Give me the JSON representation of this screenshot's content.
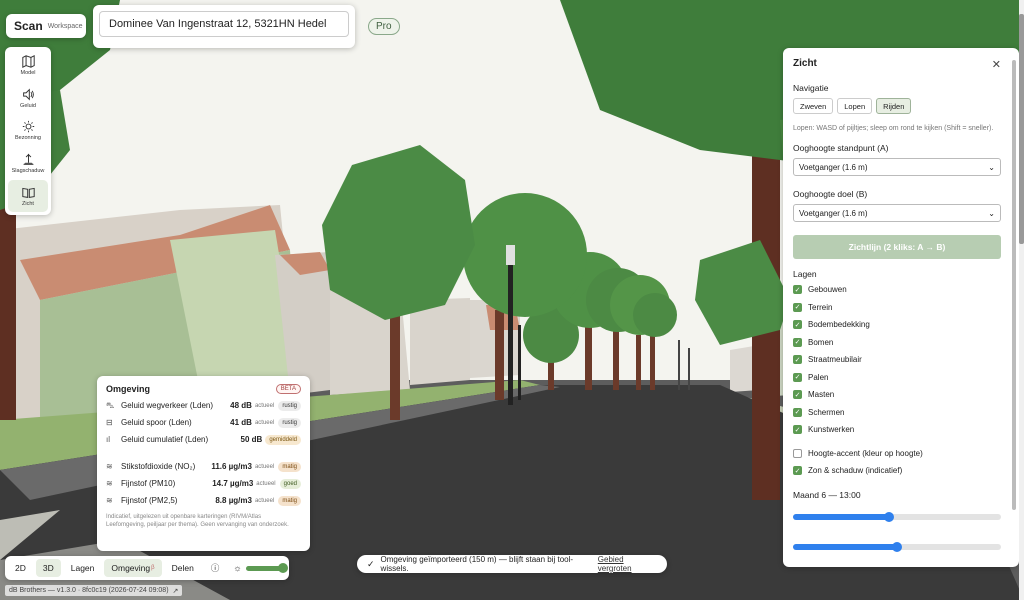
{
  "brand": {
    "name": "Scan",
    "workspace": "Workspace"
  },
  "address": {
    "value": "Dominee Van Ingenstraat 12, 5321HN Hedel"
  },
  "plan_badge": "Pro",
  "tools": [
    {
      "label": "Model",
      "icon": "map-icon"
    },
    {
      "label": "Geluid",
      "icon": "speaker-icon"
    },
    {
      "label": "Bezonning",
      "icon": "sun-icon"
    },
    {
      "label": "Slagschaduw",
      "icon": "shadow-icon"
    },
    {
      "label": "Zicht",
      "icon": "open-book-icon"
    }
  ],
  "environment": {
    "title": "Omgeving",
    "badge": "BETA",
    "rows": [
      {
        "name": "Geluid wegverkeer (Lden)",
        "value": "48 dB",
        "status": "actueel",
        "rating": "rustig",
        "icon": "car-icon"
      },
      {
        "name": "Geluid spoor (Lden)",
        "value": "41 dB",
        "status": "actueel",
        "rating": "rustig",
        "icon": "train-icon"
      },
      {
        "name": "Geluid cumulatief (Lden)",
        "value": "50 dB",
        "status": "",
        "rating": "gemiddeld",
        "icon": "sound-bars-icon"
      },
      {
        "name": "Stikstofdioxide (NO₂)",
        "value": "11.6 µg/m3",
        "status": "actueel",
        "rating": "matig",
        "icon": "wind-icon"
      },
      {
        "name": "Fijnstof (PM10)",
        "value": "14.7 µg/m3",
        "status": "actueel",
        "rating": "goed",
        "icon": "wind-icon"
      },
      {
        "name": "Fijnstof (PM2,5)",
        "value": "8.8 µg/m3",
        "status": "actueel",
        "rating": "matig",
        "icon": "wind-icon"
      }
    ],
    "note": "Indicatief, uitgelezen uit openbare karteringen (RIVM/Atlas Leefomgeving, peiljaar per thema). Geen vervanging van onderzoek."
  },
  "bottombar": {
    "view_2d": "2D",
    "view_3d": "3D",
    "layers": "Lagen",
    "environment": "Omgeving",
    "environment_sup": "β",
    "share": "Delen",
    "light_level": 1.0
  },
  "version": "dB Brothers — v1.3.0 · 8fc0c19 (2026-07-24 09:08)",
  "version_link": "↗",
  "toast": {
    "message": "Omgeving geïmporteerd (150 m) — blijft staan bij tool-wissels.",
    "link": "Gebied vergroten"
  },
  "zicht": {
    "title": "Zicht",
    "navigation_label": "Navigatie",
    "nav_modes": [
      "Zweven",
      "Lopen",
      "Rijden"
    ],
    "nav_active": 2,
    "hint": "Lopen: WASD of pijltjes; sleep om rond te kijken (Shift = sneller).",
    "eye_a_label": "Ooghoogte standpunt (A)",
    "eye_a_value": "Voetganger (1.6 m)",
    "eye_b_label": "Ooghoogte doel (B)",
    "eye_b_value": "Voetganger (1.6 m)",
    "sightline_button": "Zichtlijn (2 kliks: A → B)",
    "layers_label": "Lagen",
    "layers": [
      {
        "label": "Gebouwen",
        "checked": true
      },
      {
        "label": "Terrein",
        "checked": true
      },
      {
        "label": "Bodembedekking",
        "checked": true
      },
      {
        "label": "Bomen",
        "checked": true
      },
      {
        "label": "Straatmeubilair",
        "checked": true
      },
      {
        "label": "Palen",
        "checked": true
      },
      {
        "label": "Masten",
        "checked": true
      },
      {
        "label": "Schermen",
        "checked": true
      },
      {
        "label": "Kunstwerken",
        "checked": true
      }
    ],
    "options": [
      {
        "label": "Hoogte-accent (kleur op hoogte)",
        "checked": false
      },
      {
        "label": "Zon & schaduw (indicatief)",
        "checked": true
      }
    ],
    "time_label": "Maand 6 — 13:00",
    "month_fraction": 0.46,
    "hour_fraction": 0.5
  },
  "colors": {
    "accent": "#5c9a52",
    "slider": "#2f80ed",
    "sky": "#f4f4ef"
  }
}
